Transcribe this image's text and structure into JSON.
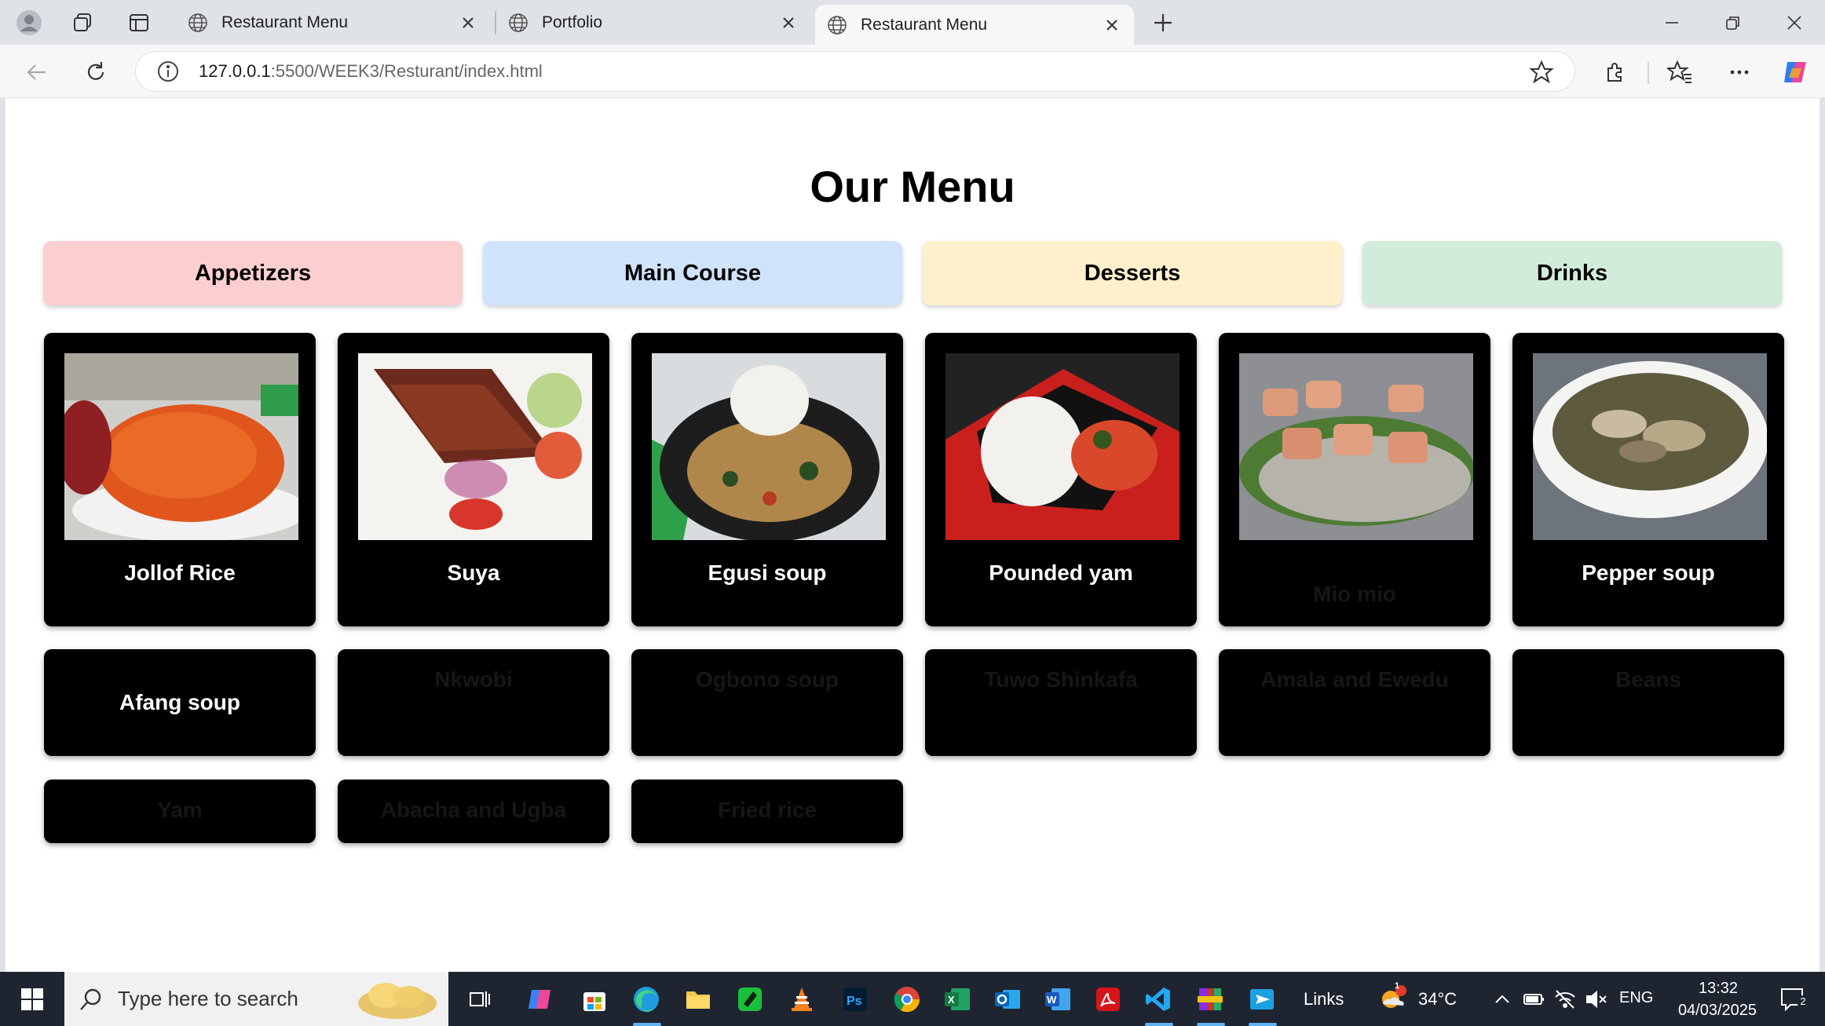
{
  "browser": {
    "tabs": [
      {
        "title": "Restaurant Menu",
        "active": false
      },
      {
        "title": "Portfolio",
        "active": false
      },
      {
        "title": "Restaurant Menu",
        "active": true
      }
    ],
    "address": {
      "host": "127.0.0.1",
      "path": ":5500/WEEK3/Resturant/index.html"
    }
  },
  "page": {
    "title": "Our Menu",
    "categories": [
      {
        "label": "Appetizers",
        "color": "#fbcfcf"
      },
      {
        "label": "Main Course",
        "color": "#cfe3fc"
      },
      {
        "label": "Desserts",
        "color": "#fdf0cb"
      },
      {
        "label": "Drinks",
        "color": "#d1ecd9"
      }
    ],
    "items": [
      {
        "name": "Jollof Rice",
        "image": "jollof-rice-photo"
      },
      {
        "name": "Suya",
        "image": "suya-photo"
      },
      {
        "name": "Egusi soup",
        "image": "egusi-soup-photo"
      },
      {
        "name": "Pounded yam",
        "image": "pounded-yam-photo"
      },
      {
        "name": "Mio mio",
        "image": "moi-moi-photo"
      },
      {
        "name": "Pepper soup",
        "image": "pepper-soup-photo"
      },
      {
        "name": "Afang soup"
      },
      {
        "name": "Nkwobi"
      },
      {
        "name": "Ogbono soup"
      },
      {
        "name": "Tuwo Shinkafa"
      },
      {
        "name": "Amala and Ewedu"
      },
      {
        "name": "Beans"
      },
      {
        "name": "Yam"
      },
      {
        "name": "Abacha and Ugba"
      },
      {
        "name": "Fried rice"
      }
    ]
  },
  "taskbar": {
    "search_placeholder": "Type here to search",
    "links_label": "Links",
    "weather": "34°C",
    "weather_badge": "1",
    "language": "ENG",
    "time": "13:32",
    "date": "04/03/2025",
    "notifications": "2"
  },
  "colors": {
    "accent": "#5fb2f2",
    "card": "#000000"
  }
}
